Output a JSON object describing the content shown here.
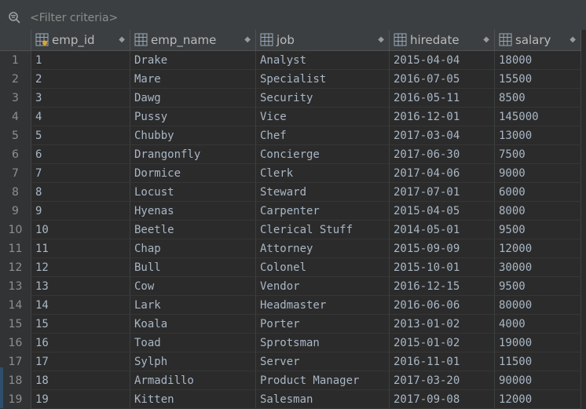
{
  "filter": {
    "placeholder": "<Filter criteria>"
  },
  "columns": [
    {
      "label": "emp_id",
      "icon": "primary-key-column-icon"
    },
    {
      "label": "emp_name",
      "icon": "column-icon"
    },
    {
      "label": "job",
      "icon": "column-icon"
    },
    {
      "label": "hiredate",
      "icon": "column-icon"
    },
    {
      "label": "salary",
      "icon": "column-icon"
    }
  ],
  "sort_glyph": "◆",
  "rows": [
    {
      "n": "1",
      "id": "1",
      "name": "Drake",
      "job": "Analyst",
      "hire": "2015-04-04",
      "salary": "18000"
    },
    {
      "n": "2",
      "id": "2",
      "name": "Mare",
      "job": "Specialist",
      "hire": "2016-07-05",
      "salary": "15500"
    },
    {
      "n": "3",
      "id": "3",
      "name": "Dawg",
      "job": "Security",
      "hire": "2016-05-11",
      "salary": "8500"
    },
    {
      "n": "4",
      "id": "4",
      "name": "Pussy",
      "job": "Vice",
      "hire": "2016-12-01",
      "salary": "145000"
    },
    {
      "n": "5",
      "id": "5",
      "name": "Chubby",
      "job": "Chef",
      "hire": "2017-03-04",
      "salary": "13000"
    },
    {
      "n": "6",
      "id": "6",
      "name": "Drangonfly",
      "job": "Concierge",
      "hire": "2017-06-30",
      "salary": "7500"
    },
    {
      "n": "7",
      "id": "7",
      "name": "Dormice",
      "job": "Clerk",
      "hire": "2017-04-06",
      "salary": "9000"
    },
    {
      "n": "8",
      "id": "8",
      "name": "Locust",
      "job": "Steward",
      "hire": "2017-07-01",
      "salary": "6000"
    },
    {
      "n": "9",
      "id": "9",
      "name": "Hyenas",
      "job": "Carpenter",
      "hire": "2015-04-05",
      "salary": "8000"
    },
    {
      "n": "10",
      "id": "10",
      "name": "Beetle",
      "job": "Clerical Stuff",
      "hire": "2014-05-01",
      "salary": "9500"
    },
    {
      "n": "11",
      "id": "11",
      "name": "Chap",
      "job": "Attorney",
      "hire": "2015-09-09",
      "salary": "12000"
    },
    {
      "n": "12",
      "id": "12",
      "name": "Bull",
      "job": "Colonel",
      "hire": "2015-10-01",
      "salary": "30000"
    },
    {
      "n": "13",
      "id": "13",
      "name": "Cow",
      "job": "Vendor",
      "hire": "2016-12-15",
      "salary": "9500"
    },
    {
      "n": "14",
      "id": "14",
      "name": "Lark",
      "job": "Headmaster",
      "hire": "2016-06-06",
      "salary": "80000"
    },
    {
      "n": "15",
      "id": "15",
      "name": "Koala",
      "job": "Porter",
      "hire": "2013-01-02",
      "salary": "4000"
    },
    {
      "n": "16",
      "id": "16",
      "name": "Toad",
      "job": "Sprotsman",
      "hire": "2015-01-02",
      "salary": "19000"
    },
    {
      "n": "17",
      "id": "17",
      "name": "Sylph",
      "job": "Server",
      "hire": "2016-11-01",
      "salary": "11500"
    },
    {
      "n": "18",
      "id": "18",
      "name": "Armadillo",
      "job": "Product Manager",
      "hire": "2017-03-20",
      "salary": "90000"
    },
    {
      "n": "19",
      "id": "19",
      "name": "Kitten",
      "job": "Salesman",
      "hire": "2017-09-08",
      "salary": "12000"
    }
  ]
}
